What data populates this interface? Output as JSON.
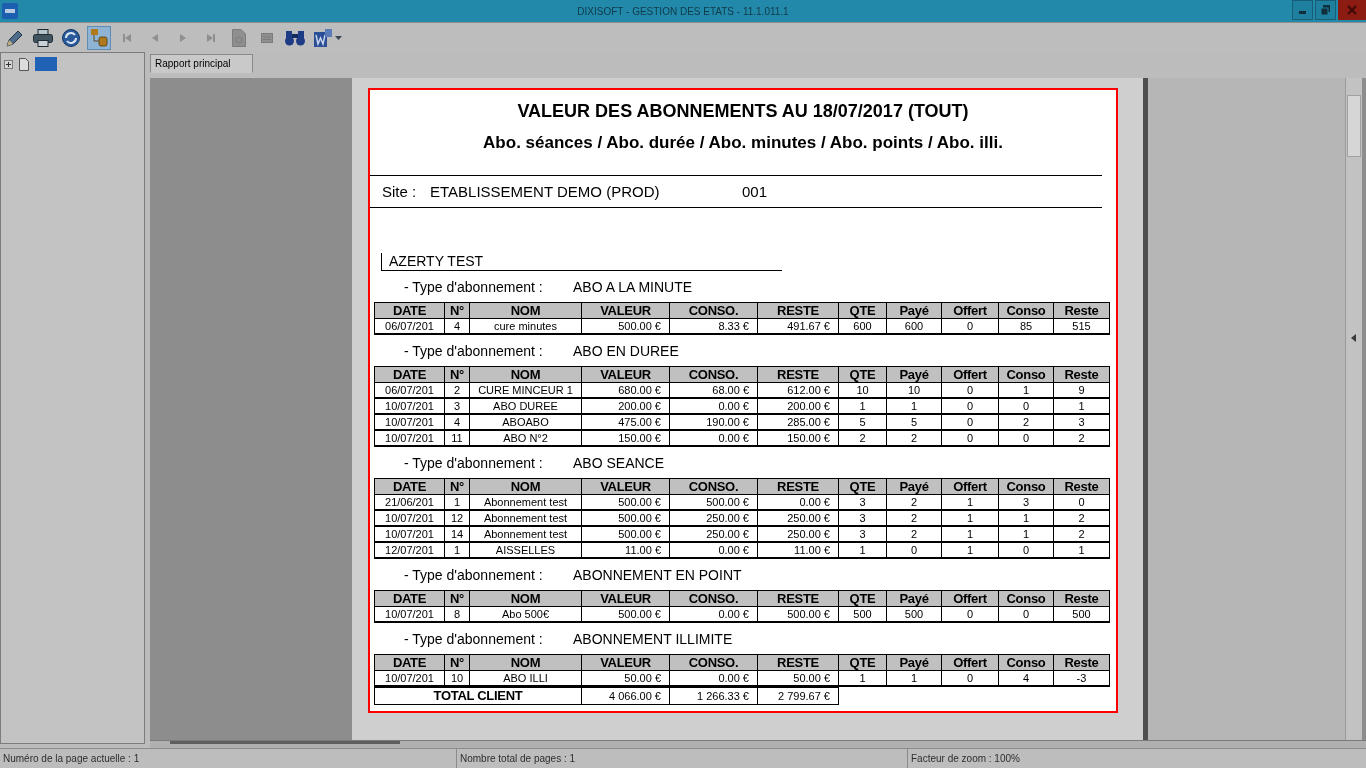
{
  "window": {
    "title": "DIXISOFT - GESTION DES ETATS - 11.1.011.1"
  },
  "toolbar": [
    {
      "kind": "pencil",
      "selected": false,
      "disabled": false,
      "dropdown": false
    },
    {
      "kind": "printer",
      "selected": false,
      "disabled": false,
      "dropdown": false
    },
    {
      "kind": "refresh",
      "selected": false,
      "disabled": false,
      "dropdown": false
    },
    {
      "kind": "tree",
      "selected": true,
      "disabled": false,
      "dropdown": false
    },
    {
      "kind": "first",
      "selected": false,
      "disabled": true,
      "dropdown": false
    },
    {
      "kind": "previous",
      "selected": false,
      "disabled": true,
      "dropdown": false
    },
    {
      "kind": "next",
      "selected": false,
      "disabled": true,
      "dropdown": false
    },
    {
      "kind": "last",
      "selected": false,
      "disabled": true,
      "dropdown": false
    },
    {
      "kind": "page",
      "selected": false,
      "disabled": true,
      "dropdown": false
    },
    {
      "kind": "panel",
      "selected": false,
      "disabled": true,
      "dropdown": false
    },
    {
      "kind": "binoculars",
      "selected": false,
      "disabled": false,
      "dropdown": false
    },
    {
      "kind": "export",
      "selected": false,
      "disabled": false,
      "dropdown": true
    }
  ],
  "tree": [
    {
      "expanded": false,
      "selected": true
    }
  ],
  "tabs": [
    {
      "label": "Rapport principal",
      "selected": true
    }
  ],
  "report": {
    "title": "VALEUR DES ABONNEMENTS AU 18/07/2017 (TOUT)",
    "subtitle": "Abo. séances / Abo. durée / Abo. minutes / Abo. points / Abo. illi.",
    "site": {
      "label": "Site :",
      "name": "ETABLISSEMENT DEMO (PROD)",
      "code": "001"
    },
    "client": {
      "name": "AZERTY TEST",
      "sections": [
        {
          "label": "- Type d'abonnement :",
          "type": "ABO A LA MINUTE",
          "columns": [
            "DATE",
            "N°",
            "NOM",
            "VALEUR",
            "CONSO.",
            "RESTE",
            "QTE",
            "Payé",
            "Offert",
            "Conso",
            "Reste"
          ],
          "rows": [
            [
              "06/07/201",
              "4",
              "cure minutes",
              "500.00 €",
              "8.33 €",
              "491.67 €",
              "600",
              "600",
              "0",
              "85",
              "515"
            ]
          ]
        },
        {
          "label": "- Type d'abonnement :",
          "type": "ABO EN DUREE",
          "columns": [
            "DATE",
            "N°",
            "NOM",
            "VALEUR",
            "CONSO.",
            "RESTE",
            "QTE",
            "Payé",
            "Offert",
            "Conso",
            "Reste"
          ],
          "rows": [
            [
              "06/07/201",
              "2",
              "CURE MINCEUR 1",
              "680.00 €",
              "68.00 €",
              "612.00 €",
              "10",
              "10",
              "0",
              "1",
              "9"
            ],
            [
              "10/07/201",
              "3",
              "ABO DUREE",
              "200.00 €",
              "0.00 €",
              "200.00 €",
              "1",
              "1",
              "0",
              "0",
              "1"
            ],
            [
              "10/07/201",
              "4",
              "ABOABO",
              "475.00 €",
              "190.00 €",
              "285.00 €",
              "5",
              "5",
              "0",
              "2",
              "3"
            ],
            [
              "10/07/201",
              "11",
              "ABO N°2",
              "150.00 €",
              "0.00 €",
              "150.00 €",
              "2",
              "2",
              "0",
              "0",
              "2"
            ]
          ]
        },
        {
          "label": "- Type d'abonnement :",
          "type": "ABO SEANCE",
          "columns": [
            "DATE",
            "N°",
            "NOM",
            "VALEUR",
            "CONSO.",
            "RESTE",
            "QTE",
            "Payé",
            "Offert",
            "Conso",
            "Reste"
          ],
          "rows": [
            [
              "21/06/201",
              "1",
              "Abonnement test",
              "500.00 €",
              "500.00 €",
              "0.00 €",
              "3",
              "2",
              "1",
              "3",
              "0"
            ],
            [
              "10/07/201",
              "12",
              "Abonnement test",
              "500.00 €",
              "250.00 €",
              "250.00 €",
              "3",
              "2",
              "1",
              "1",
              "2"
            ],
            [
              "10/07/201",
              "14",
              "Abonnement test",
              "500.00 €",
              "250.00 €",
              "250.00 €",
              "3",
              "2",
              "1",
              "1",
              "2"
            ],
            [
              "12/07/201",
              "1",
              "AISSELLES",
              "11.00 €",
              "0.00 €",
              "11.00 €",
              "1",
              "0",
              "1",
              "0",
              "1"
            ]
          ]
        },
        {
          "label": "- Type d'abonnement :",
          "type": "ABONNEMENT EN POINT",
          "columns": [
            "DATE",
            "N°",
            "NOM",
            "VALEUR",
            "CONSO.",
            "RESTE",
            "QTE",
            "Payé",
            "Offert",
            "Conso",
            "Reste"
          ],
          "rows": [
            [
              "10/07/201",
              "8",
              "Abo 500€",
              "500.00 €",
              "0.00 €",
              "500.00 €",
              "500",
              "500",
              "0",
              "0",
              "500"
            ]
          ]
        },
        {
          "label": "- Type d'abonnement :",
          "type": "ABONNEMENT ILLIMITE",
          "columns": [
            "DATE",
            "N°",
            "NOM",
            "VALEUR",
            "CONSO.",
            "RESTE",
            "QTE",
            "Payé",
            "Offert",
            "Conso",
            "Reste"
          ],
          "rows": [
            [
              "10/07/201",
              "10",
              "ABO ILLI",
              "50.00 €",
              "0.00 €",
              "50.00 €",
              "1",
              "1",
              "0",
              "4",
              "-3"
            ]
          ]
        }
      ],
      "total": {
        "label": "TOTAL CLIENT",
        "values": [
          "4 066.00 €",
          "1 266.33 €",
          "2 799.67 €"
        ]
      }
    }
  },
  "status_bar": [
    "Numéro de la page actuelle : 1",
    "Nombre total de pages : 1",
    "Facteur de zoom : 100%"
  ]
}
